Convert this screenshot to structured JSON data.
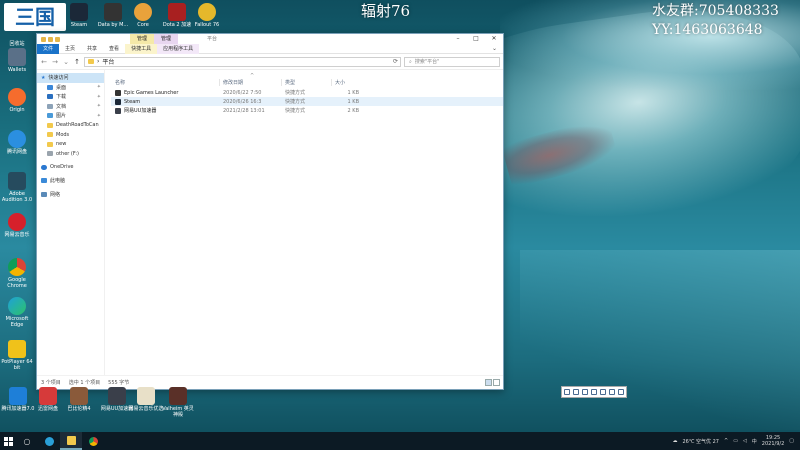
{
  "overlay": {
    "title": "辐射76",
    "qq_group": "水友群:705408333",
    "yy": "YY:1463063648"
  },
  "desktop": {
    "top_icons": [
      "Steam",
      "Data by M...",
      "Core",
      "Dota 2 加速",
      "Fallout 76"
    ],
    "left_icons": [
      "回收站",
      "Wallets",
      "Origin",
      "腾讯网盘",
      "Adobe Audition 3.0",
      "网易云音乐",
      "Google Chrome",
      "Microsoft Edge",
      "PotPlayer 64 bit"
    ],
    "bottom_icons": [
      "腾讯加速器7.0",
      "迅雷网盘",
      "巴比伦精4",
      "网易UU加速器",
      "网易云音乐优选",
      "Valheim 英灵神殿"
    ]
  },
  "explorer": {
    "window_title": "",
    "context_tabs": [
      "管理",
      "管理"
    ],
    "path_hint": "平台",
    "ribbon_tabs": [
      "文件",
      "主页",
      "共享",
      "查看",
      "快捷工具",
      "应用程序工具"
    ],
    "address": {
      "breadcrumb": "平台",
      "search_placeholder": "搜索\"平台\""
    },
    "nav_pane": {
      "quick_access": "快速访问",
      "items": [
        "桌面",
        "下载",
        "文档",
        "图片",
        "DeathRoadToCan",
        "Mods",
        "new",
        "other (F:)"
      ],
      "onedrive": "OneDrive",
      "this_pc": "此电脑",
      "network": "网络"
    },
    "columns": {
      "name": "名称",
      "date": "修改日期",
      "type": "类型",
      "size": "大小"
    },
    "files": [
      {
        "name": "Epic Games Launcher",
        "date": "2020/6/22 7:50",
        "type": "快捷方式",
        "size": "1 KB"
      },
      {
        "name": "Steam",
        "date": "2020/6/26 16:3",
        "type": "快捷方式",
        "size": "1 KB"
      },
      {
        "name": "网易UU加速器",
        "date": "2021/2/28 13:01",
        "type": "快捷方式",
        "size": "2 KB"
      }
    ],
    "status": {
      "count": "3 个项目",
      "selected": "选中 1 个项目",
      "size": "555 字节"
    }
  },
  "taskbar": {
    "weather": "26℃ 空气优 27",
    "time": "19:25",
    "date": "2021/9/2"
  },
  "colors": {
    "accent": "#1a73c9",
    "selection": "#cce4f7",
    "taskbar": "#0c1a24"
  }
}
